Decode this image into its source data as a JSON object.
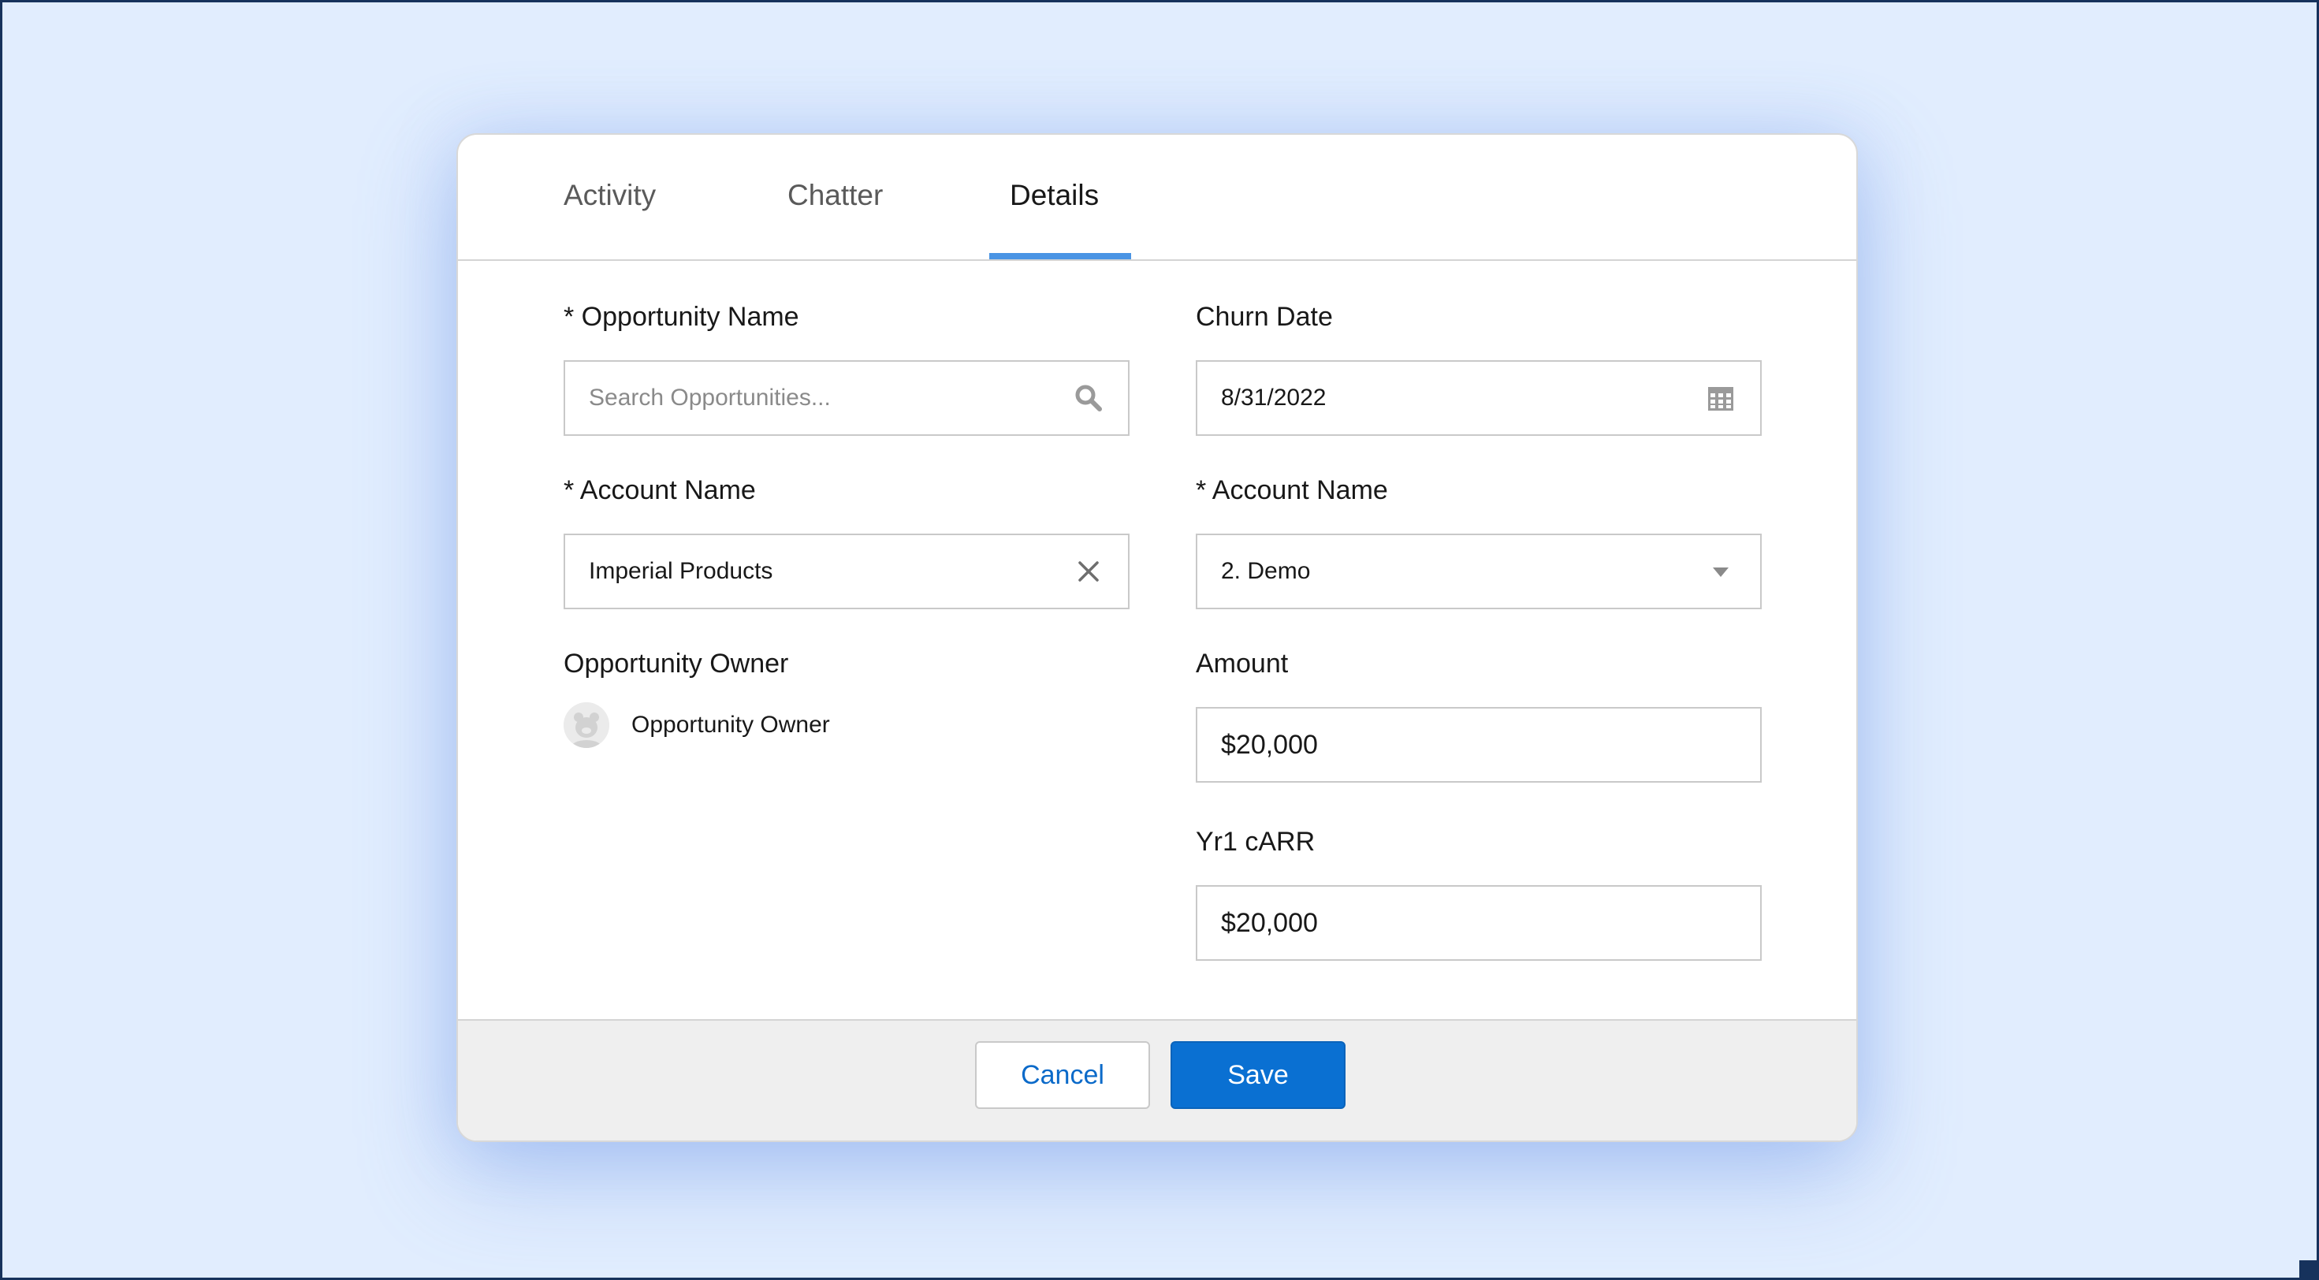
{
  "tabs": [
    {
      "label": "Activity"
    },
    {
      "label": "Chatter"
    },
    {
      "label": "Details",
      "active": true
    }
  ],
  "form": {
    "opportunity_name": {
      "label": "* Opportunity Name",
      "placeholder": "Search Opportunities..."
    },
    "account_name_left": {
      "label": "* Account Name",
      "value": "Imperial Products"
    },
    "opportunity_owner": {
      "label": "Opportunity Owner",
      "name": "Opportunity Owner"
    },
    "churn_date": {
      "label": "Churn Date",
      "value": "8/31/2022"
    },
    "account_name_right": {
      "label": "* Account Name",
      "value": "2. Demo"
    },
    "amount": {
      "label": "Amount",
      "value": "$20,000"
    },
    "yr1_carr": {
      "label": "Yr1 cARR",
      "value": "$20,000"
    }
  },
  "footer": {
    "cancel_label": "Cancel",
    "save_label": "Save"
  },
  "icons": {
    "search": "search-icon",
    "calendar": "calendar-icon",
    "clear": "close-icon",
    "dropdown": "caret-down-icon",
    "avatar": "avatar-icon"
  },
  "colors": {
    "background": "#e1edfe",
    "accent": "#0a70d2",
    "tab_underline": "#4a94e4",
    "link": "#0b6ac9"
  }
}
